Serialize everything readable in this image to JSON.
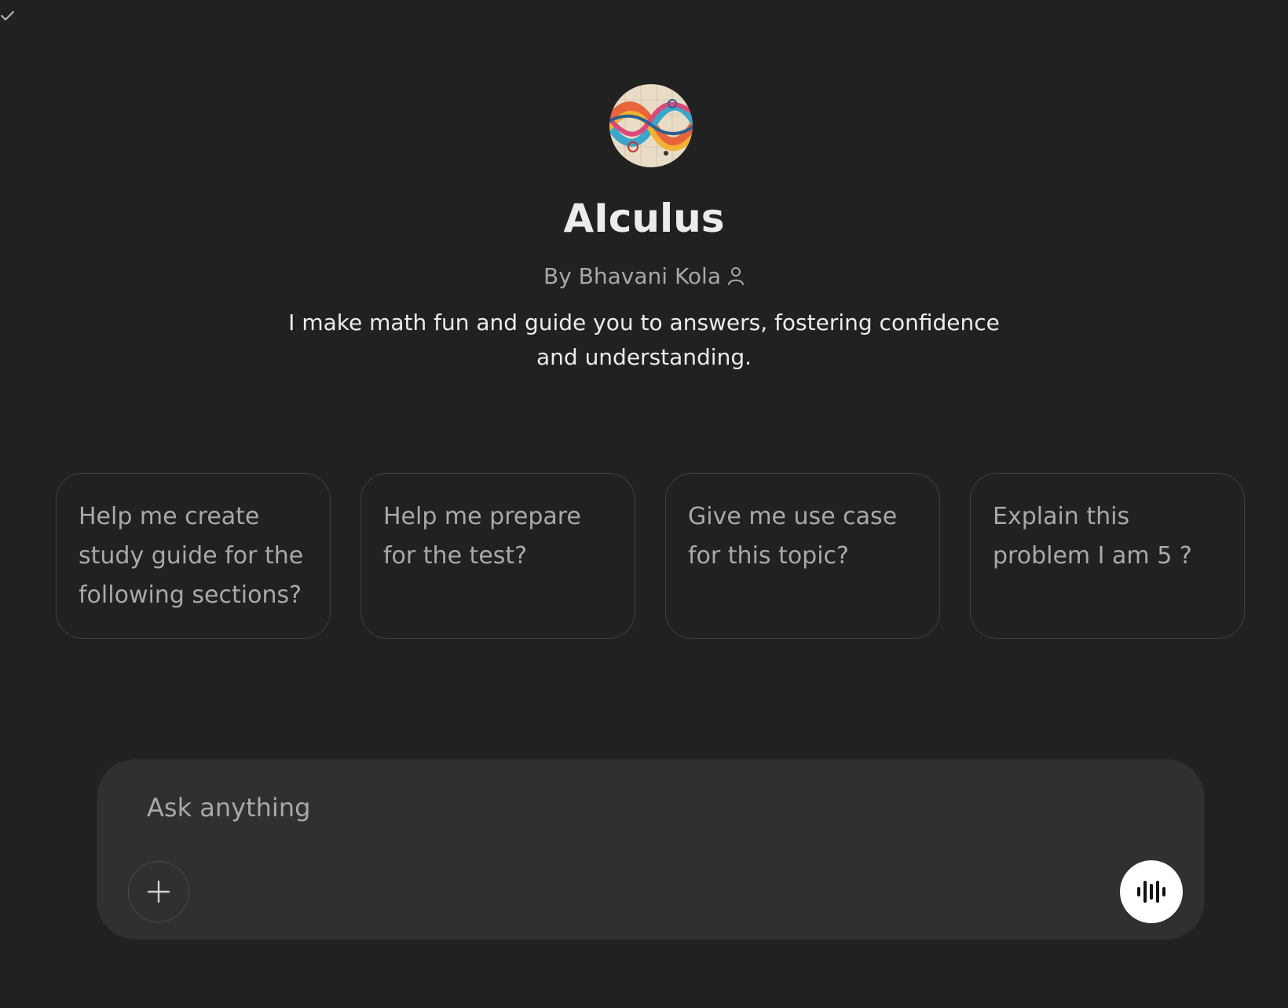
{
  "header": {
    "check_icon": "check-icon"
  },
  "gpt": {
    "name": "AIculus",
    "author": "By Bhavani Kola",
    "author_icon": "person-icon",
    "description": "I make math fun and guide you to answers, fostering confidence and understanding."
  },
  "prompts": [
    {
      "label": "Help me create study guide for the following sections?"
    },
    {
      "label": "Help me prepare for the test?"
    },
    {
      "label": "Give me use case for this topic?"
    },
    {
      "label": "Explain this problem I am 5 ?"
    }
  ],
  "composer": {
    "placeholder": "Ask anything",
    "value": "",
    "attach_icon": "plus-icon",
    "voice_icon": "voice-waveform-icon"
  },
  "colors": {
    "background": "#212121",
    "composer_bg": "#303030",
    "card_border": "#3f3f3f",
    "muted_text": "#a8a8a8",
    "text": "#ececec",
    "voice_button": "#ffffff"
  }
}
